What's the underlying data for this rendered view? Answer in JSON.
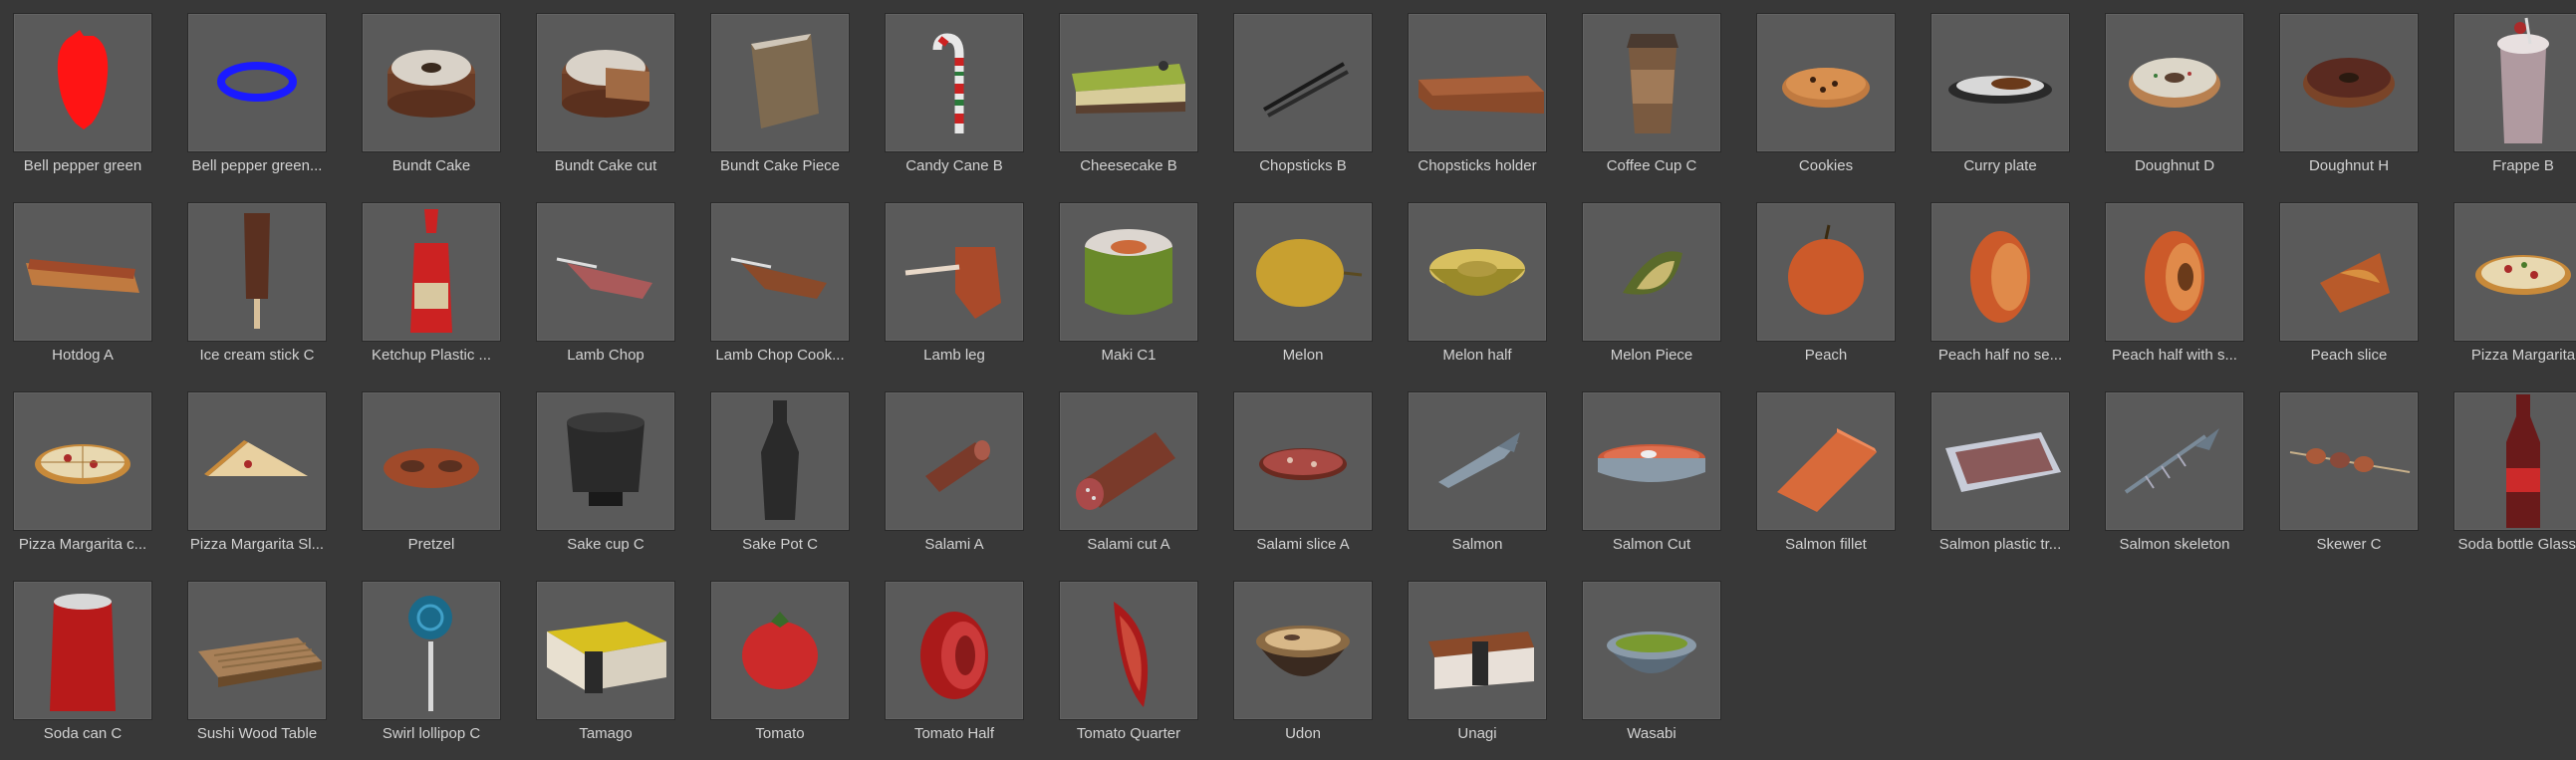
{
  "window": {
    "background_color": "#383838",
    "thumbnail_background": "#5a5a5a",
    "label_color": "#d2d2d2"
  },
  "assets": [
    {
      "label": "Bell pepper green",
      "icon": "red-bell-pepper-icon"
    },
    {
      "label": "Bell pepper green...",
      "icon": "blue-bell-pepper-ring-icon"
    },
    {
      "label": "Bundt Cake",
      "icon": "bundt-cake-icon"
    },
    {
      "label": "Bundt Cake cut",
      "icon": "bundt-cake-cut-icon"
    },
    {
      "label": "Bundt Cake Piece",
      "icon": "bundt-cake-piece-icon"
    },
    {
      "label": "Candy Cane B",
      "icon": "candy-cane-icon"
    },
    {
      "label": "Cheesecake B",
      "icon": "cheesecake-icon"
    },
    {
      "label": "Chopsticks B",
      "icon": "chopsticks-icon"
    },
    {
      "label": "Chopsticks holder",
      "icon": "chopsticks-holder-icon"
    },
    {
      "label": "Coffee Cup C",
      "icon": "coffee-cup-icon"
    },
    {
      "label": "Cookies",
      "icon": "cookies-icon"
    },
    {
      "label": "Curry plate",
      "icon": "curry-plate-icon"
    },
    {
      "label": "Doughnut D",
      "icon": "doughnut-sprinkles-icon"
    },
    {
      "label": "Doughnut H",
      "icon": "doughnut-chocolate-icon"
    },
    {
      "label": "Frappe B",
      "icon": "frappe-icon"
    },
    {
      "label": "Hotdog A",
      "icon": "hotdog-icon"
    },
    {
      "label": "Ice cream stick C",
      "icon": "ice-cream-stick-icon"
    },
    {
      "label": "Ketchup Plastic ...",
      "icon": "ketchup-bottle-icon"
    },
    {
      "label": "Lamb Chop",
      "icon": "lamb-chop-icon"
    },
    {
      "label": "Lamb Chop Cook...",
      "icon": "lamb-chop-cooked-icon"
    },
    {
      "label": "Lamb leg",
      "icon": "lamb-leg-icon"
    },
    {
      "label": "Maki C1",
      "icon": "maki-icon"
    },
    {
      "label": "Melon",
      "icon": "melon-icon"
    },
    {
      "label": "Melon half",
      "icon": "melon-half-icon"
    },
    {
      "label": "Melon Piece",
      "icon": "melon-piece-icon"
    },
    {
      "label": "Peach",
      "icon": "peach-icon"
    },
    {
      "label": "Peach half no se...",
      "icon": "peach-half-icon"
    },
    {
      "label": "Peach half with s...",
      "icon": "peach-half-seed-icon"
    },
    {
      "label": "Peach slice",
      "icon": "peach-slice-icon"
    },
    {
      "label": "Pizza Margarita",
      "icon": "pizza-icon"
    },
    {
      "label": "Pizza Margarita c...",
      "icon": "pizza-cut-icon"
    },
    {
      "label": "Pizza Margarita Sl...",
      "icon": "pizza-slice-icon"
    },
    {
      "label": "Pretzel",
      "icon": "pretzel-icon"
    },
    {
      "label": "Sake cup C",
      "icon": "sake-cup-icon"
    },
    {
      "label": "Sake Pot C",
      "icon": "sake-pot-icon"
    },
    {
      "label": "Salami A",
      "icon": "salami-icon"
    },
    {
      "label": "Salami cut A",
      "icon": "salami-cut-icon"
    },
    {
      "label": "Salami slice A",
      "icon": "salami-slice-icon"
    },
    {
      "label": "Salmon",
      "icon": "salmon-fish-icon"
    },
    {
      "label": "Salmon Cut",
      "icon": "salmon-cut-icon"
    },
    {
      "label": "Salmon fillet",
      "icon": "salmon-fillet-icon"
    },
    {
      "label": "Salmon plastic tr...",
      "icon": "salmon-tray-icon"
    },
    {
      "label": "Salmon skeleton",
      "icon": "salmon-skeleton-icon"
    },
    {
      "label": "Skewer C",
      "icon": "skewer-icon"
    },
    {
      "label": "Soda bottle Glass...",
      "icon": "soda-bottle-icon"
    },
    {
      "label": "Soda can C",
      "icon": "soda-can-icon"
    },
    {
      "label": "Sushi Wood Table",
      "icon": "sushi-table-icon"
    },
    {
      "label": "Swirl lollipop C",
      "icon": "lollipop-icon"
    },
    {
      "label": "Tamago",
      "icon": "tamago-icon"
    },
    {
      "label": "Tomato",
      "icon": "tomato-icon"
    },
    {
      "label": "Tomato Half",
      "icon": "tomato-half-icon"
    },
    {
      "label": "Tomato Quarter",
      "icon": "tomato-quarter-icon"
    },
    {
      "label": "Udon",
      "icon": "udon-bowl-icon"
    },
    {
      "label": "Unagi",
      "icon": "unagi-icon"
    },
    {
      "label": "Wasabi",
      "icon": "wasabi-bowl-icon"
    }
  ]
}
